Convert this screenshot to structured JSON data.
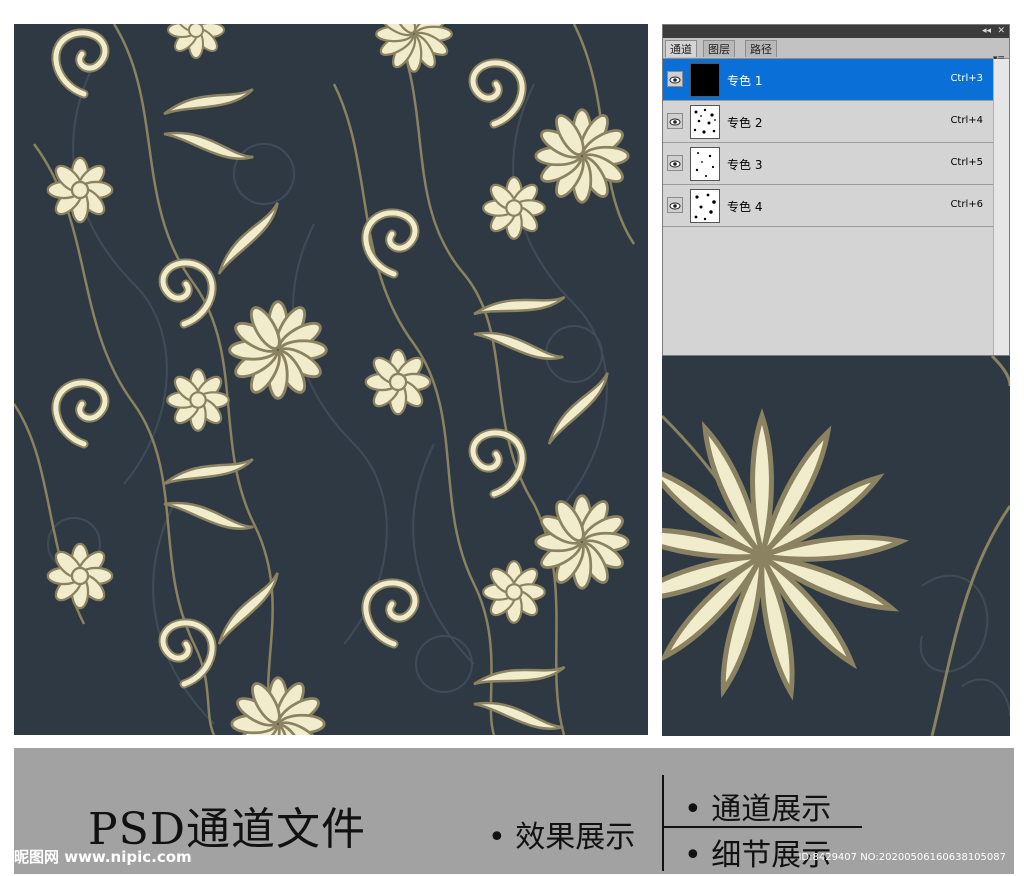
{
  "panel": {
    "tabs": [
      "通道",
      "图层",
      "路径"
    ],
    "active_tab": 0,
    "controls": {
      "collapse": "◂◂",
      "close": "✕",
      "menu": "▾≡"
    },
    "channels": [
      {
        "name": "专色 1",
        "shortcut": "Ctrl+3",
        "selected": true
      },
      {
        "name": "专色 2",
        "shortcut": "Ctrl+4",
        "selected": false
      },
      {
        "name": "专色 3",
        "shortcut": "Ctrl+5",
        "selected": false
      },
      {
        "name": "专色 4",
        "shortcut": "Ctrl+6",
        "selected": false
      }
    ]
  },
  "banner": {
    "title": "PSD通道文件",
    "effect": "效果展示",
    "channel": "通道展示",
    "detail": "细节展示",
    "watermark_left": "昵图网 www.nipic.com",
    "watermark_right": "ID:8429407 NO:20200506160638105087"
  },
  "colors": {
    "background": "#2f3944",
    "flower": "#f1eccb",
    "stroke": "#8a8260",
    "selection": "#0a6fd6"
  },
  "icons": {
    "eye": "eye-icon",
    "thumbnail": "channel-thumbnail"
  }
}
